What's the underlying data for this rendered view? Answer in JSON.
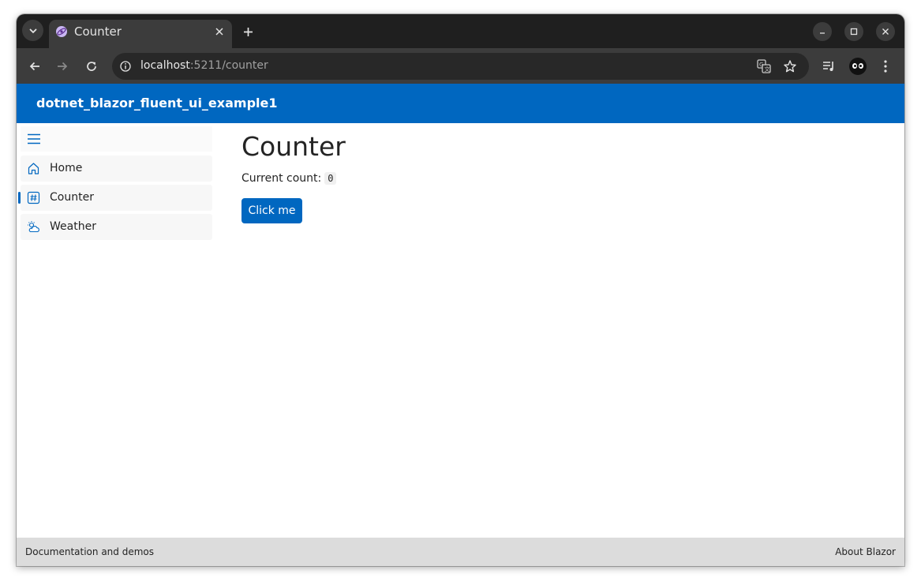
{
  "browser": {
    "tab": {
      "title": "Counter",
      "favicon": "blazor-icon"
    },
    "url": {
      "host": "localhost",
      "rest": ":5211/counter"
    }
  },
  "app": {
    "title": "dotnet_blazor_fluent_ui_example1",
    "accent": "#0067c0"
  },
  "nav": {
    "items": [
      {
        "label": "Home",
        "icon": "home-icon"
      },
      {
        "label": "Counter",
        "icon": "number-icon",
        "active": true
      },
      {
        "label": "Weather",
        "icon": "weather-icon"
      }
    ]
  },
  "page": {
    "title": "Counter",
    "count_label": "Current count:",
    "count_value": "0",
    "button_label": "Click me"
  },
  "footer": {
    "left": "Documentation and demos",
    "right": "About Blazor"
  }
}
